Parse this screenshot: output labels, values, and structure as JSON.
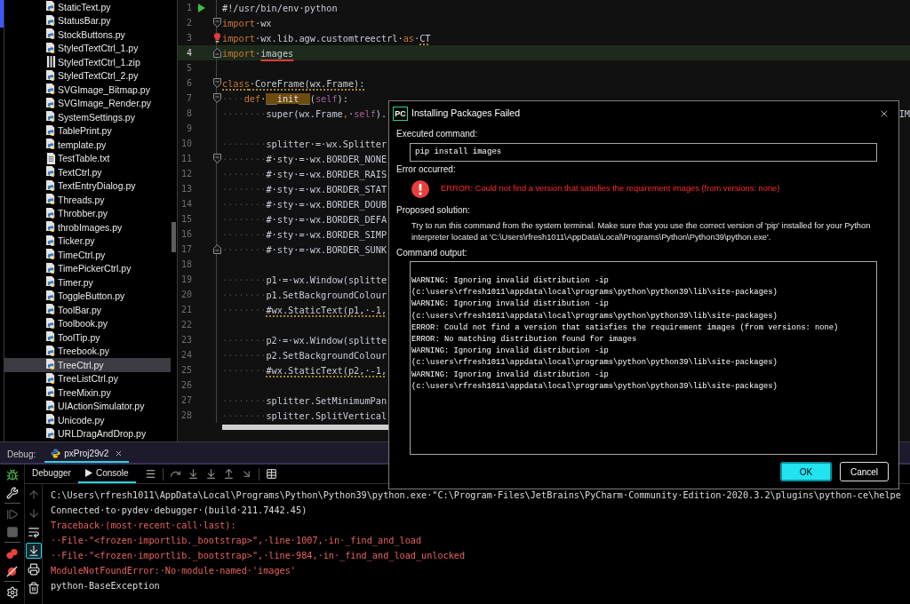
{
  "project_tree": {
    "items": [
      {
        "name": "StaticText.py",
        "kind": "python",
        "selected": false
      },
      {
        "name": "StatusBar.py",
        "kind": "python",
        "selected": false
      },
      {
        "name": "StockButtons.py",
        "kind": "python",
        "selected": false
      },
      {
        "name": "StyledTextCtrl_1.py",
        "kind": "python",
        "selected": false
      },
      {
        "name": "StyledTextCtrl_1.zip",
        "kind": "archive",
        "selected": false
      },
      {
        "name": "StyledTextCtrl_2.py",
        "kind": "python",
        "selected": false
      },
      {
        "name": "SVGImage_Bitmap.py",
        "kind": "python",
        "selected": false
      },
      {
        "name": "SVGImage_Render.py",
        "kind": "python",
        "selected": false
      },
      {
        "name": "SystemSettings.py",
        "kind": "python",
        "selected": false
      },
      {
        "name": "TablePrint.py",
        "kind": "python",
        "selected": false
      },
      {
        "name": "template.py",
        "kind": "python",
        "selected": false
      },
      {
        "name": "TestTable.txt",
        "kind": "text",
        "selected": false
      },
      {
        "name": "TextCtrl.py",
        "kind": "python",
        "selected": false
      },
      {
        "name": "TextEntryDialog.py",
        "kind": "python",
        "selected": false
      },
      {
        "name": "Threads.py",
        "kind": "python",
        "selected": false
      },
      {
        "name": "Throbber.py",
        "kind": "python",
        "selected": false
      },
      {
        "name": "throbImages.py",
        "kind": "python",
        "selected": false
      },
      {
        "name": "Ticker.py",
        "kind": "python",
        "selected": false
      },
      {
        "name": "TimeCtrl.py",
        "kind": "python",
        "selected": false
      },
      {
        "name": "TimePickerCtrl.py",
        "kind": "python",
        "selected": false
      },
      {
        "name": "Timer.py",
        "kind": "python",
        "selected": false
      },
      {
        "name": "ToggleButton.py",
        "kind": "python",
        "selected": false
      },
      {
        "name": "ToolBar.py",
        "kind": "python",
        "selected": false
      },
      {
        "name": "Toolbook.py",
        "kind": "python",
        "selected": false
      },
      {
        "name": "ToolTip.py",
        "kind": "python",
        "selected": false
      },
      {
        "name": "Treebook.py",
        "kind": "python",
        "selected": false
      },
      {
        "name": "TreeCtrl.py",
        "kind": "python",
        "selected": true
      },
      {
        "name": "TreeListCtrl.py",
        "kind": "python",
        "selected": false
      },
      {
        "name": "TreeMixin.py",
        "kind": "python",
        "selected": false
      },
      {
        "name": "UIActionSimulator.py",
        "kind": "python",
        "selected": false
      },
      {
        "name": "Unicode.py",
        "kind": "python",
        "selected": false
      },
      {
        "name": "URLDragAndDrop.py",
        "kind": "python",
        "selected": false
      }
    ]
  },
  "editor": {
    "lines": [
      {
        "number": "1",
        "current": false,
        "gutter": [
          {
            "kind": "run"
          }
        ],
        "segments": [
          {
            "kind": "plain",
            "text": "#!/usr/bin/env·python"
          }
        ]
      },
      {
        "number": "2",
        "current": false,
        "gutter": [
          {
            "kind": "fold-start"
          }
        ],
        "segments": [
          {
            "kind": "keyword",
            "text": "import"
          },
          {
            "kind": "plain",
            "text": "·wx"
          }
        ]
      },
      {
        "number": "3",
        "current": false,
        "gutter": [
          {
            "kind": "error-bulb"
          }
        ],
        "segments": [
          {
            "kind": "keyword",
            "text": "import"
          },
          {
            "kind": "plain",
            "text": "·wx.lib.agw.customtreectrl·"
          },
          {
            "kind": "keyword",
            "text": "as"
          },
          {
            "kind": "plain",
            "text": "·"
          },
          {
            "kind": "plain-dotted",
            "text": "CT"
          }
        ]
      },
      {
        "number": "4",
        "current": true,
        "gutter": [
          {
            "kind": "fold-end"
          }
        ],
        "segments": [
          {
            "kind": "keyword",
            "text": "import"
          },
          {
            "kind": "plain",
            "text": "·"
          },
          {
            "kind": "plain-error",
            "text": "images"
          }
        ]
      },
      {
        "number": "5",
        "current": false
      },
      {
        "number": "6",
        "current": false,
        "gutter": [
          {
            "kind": "fold-start"
          }
        ],
        "segments": [
          {
            "kind": "keyword-dotted",
            "text": "class"
          },
          {
            "kind": "plain-dotted",
            "text": "·CoreFrame(wx.Frame):"
          }
        ]
      },
      {
        "number": "7",
        "current": false,
        "gutter": [
          {
            "kind": "fold-start"
          }
        ],
        "segments": [
          {
            "kind": "indent",
            "text": "····"
          },
          {
            "kind": "keyword",
            "text": "def"
          },
          {
            "kind": "plain",
            "text": "·"
          },
          {
            "kind": "highlight",
            "text": "__init__"
          },
          {
            "kind": "plain",
            "text": "("
          },
          {
            "kind": "self",
            "text": "self"
          },
          {
            "kind": "plain",
            "text": "):"
          }
        ]
      },
      {
        "number": "8",
        "current": false,
        "segments": [
          {
            "kind": "indent",
            "text": "········"
          },
          {
            "kind": "plain",
            "text": "super(wx.Frame"
          },
          {
            "kind": "keyword",
            "text": ","
          },
          {
            "kind": "plain",
            "text": "·"
          },
          {
            "kind": "self",
            "text": "self"
          },
          {
            "kind": "plain",
            "text": ")."
          }
        ],
        "tail": "IM"
      },
      {
        "number": "9",
        "current": false
      },
      {
        "number": "10",
        "current": false,
        "segments": [
          {
            "kind": "indent",
            "text": "········"
          },
          {
            "kind": "plain",
            "text": "splitter·=·wx.Splitter"
          }
        ]
      },
      {
        "number": "11",
        "current": false,
        "gutter": [
          {
            "kind": "fold-start"
          }
        ],
        "segments": [
          {
            "kind": "indent",
            "text": "········"
          },
          {
            "kind": "plain",
            "text": "#·sty·=·wx.BORDER_NONE"
          }
        ]
      },
      {
        "number": "12",
        "current": false,
        "segments": [
          {
            "kind": "indent",
            "text": "········"
          },
          {
            "kind": "plain",
            "text": "#·sty·=·wx.BORDER_RAIS"
          }
        ]
      },
      {
        "number": "13",
        "current": false,
        "segments": [
          {
            "kind": "indent",
            "text": "········"
          },
          {
            "kind": "plain",
            "text": "#·sty·=·wx.BORDER_STAT"
          }
        ]
      },
      {
        "number": "14",
        "current": false,
        "segments": [
          {
            "kind": "indent",
            "text": "········"
          },
          {
            "kind": "plain",
            "text": "#·sty·=·wx.BORDER_DOUB"
          }
        ]
      },
      {
        "number": "15",
        "current": false,
        "segments": [
          {
            "kind": "indent",
            "text": "········"
          },
          {
            "kind": "plain",
            "text": "#·sty·=·wx.BORDER_DEFA"
          }
        ]
      },
      {
        "number": "16",
        "current": false,
        "segments": [
          {
            "kind": "indent",
            "text": "········"
          },
          {
            "kind": "plain",
            "text": "#·sty·=·wx.BORDER_SIMP"
          }
        ]
      },
      {
        "number": "17",
        "current": false,
        "gutter": [
          {
            "kind": "fold-end"
          }
        ],
        "segments": [
          {
            "kind": "indent",
            "text": "········"
          },
          {
            "kind": "plain",
            "text": "#·sty·=·wx.BORDER_SUNK"
          }
        ]
      },
      {
        "number": "18",
        "current": false
      },
      {
        "number": "19",
        "current": false,
        "segments": [
          {
            "kind": "indent",
            "text": "········"
          },
          {
            "kind": "plain",
            "text": "p1·=·wx.Window(splitte"
          }
        ]
      },
      {
        "number": "20",
        "current": false,
        "segments": [
          {
            "kind": "indent",
            "text": "········"
          },
          {
            "kind": "plain",
            "text": "p1.SetBackgroundColour"
          }
        ]
      },
      {
        "number": "21",
        "current": false,
        "segments": [
          {
            "kind": "indent",
            "text": "········"
          },
          {
            "kind": "plain-dotted",
            "text": "#wx.StaticText(p1,·-1,"
          }
        ]
      },
      {
        "number": "22",
        "current": false
      },
      {
        "number": "23",
        "current": false,
        "segments": [
          {
            "kind": "indent",
            "text": "········"
          },
          {
            "kind": "plain",
            "text": "p2·=·wx.Window(splitte"
          }
        ]
      },
      {
        "number": "24",
        "current": false,
        "segments": [
          {
            "kind": "indent",
            "text": "········"
          },
          {
            "kind": "plain",
            "text": "p2.SetBackgroundColour"
          }
        ]
      },
      {
        "number": "25",
        "current": false,
        "segments": [
          {
            "kind": "indent",
            "text": "········"
          },
          {
            "kind": "plain-dotted",
            "text": "#wx.StaticText(p2,·-1,"
          }
        ]
      },
      {
        "number": "26",
        "current": false
      },
      {
        "number": "27",
        "current": false,
        "segments": [
          {
            "kind": "indent",
            "text": "········"
          },
          {
            "kind": "plain",
            "text": "splitter.SetMinimumPan"
          }
        ]
      },
      {
        "number": "28",
        "current": false,
        "segments": [
          {
            "kind": "indent",
            "text": "········"
          },
          {
            "kind": "plain",
            "text": "splitter.SplitVertical"
          }
        ]
      }
    ]
  },
  "dialog": {
    "logo_text": "PC",
    "title": "Installing Packages Failed",
    "executed_label": "Executed command:",
    "command": "pip install images",
    "error_label": "Error occurred:",
    "error_message": "ERROR: Could not find a version that satisfies the requirement images (from versions: none)",
    "solution_label": "Proposed solution:",
    "solution_text": "Try to run this command from the system terminal. Make sure that you use the correct version of 'pip' installed for your Python interpreter located at 'C:\\Users\\rfresh1011\\AppData\\Local\\Programs\\Python\\Python39\\python.exe'.",
    "output_label": "Command output:",
    "output_lines": [
      "WARNING: Ignoring invalid distribution -ip",
      "(c:\\users\\rfresh1011\\appdata\\local\\programs\\python\\python39\\lib\\site-packages)",
      "WARNING: Ignoring invalid distribution -ip",
      "(c:\\users\\rfresh1011\\appdata\\local\\programs\\python\\python39\\lib\\site-packages)",
      "ERROR: Could not find a version that satisfies the requirement images (from versions: none)",
      "ERROR: No matching distribution found for images",
      "WARNING: Ignoring invalid distribution -ip",
      "(c:\\users\\rfresh1011\\appdata\\local\\programs\\python\\python39\\lib\\site-packages)",
      "WARNING: Ignoring invalid distribution -ip",
      "(c:\\users\\rfresh1011\\appdata\\local\\programs\\python\\python39\\lib\\site-packages)"
    ],
    "buttons": [
      {
        "label": "OK",
        "focused": true
      },
      {
        "label": "Cancel",
        "focused": false
      }
    ]
  },
  "debug_panel": {
    "label": "Debug:",
    "run_tabs": [
      {
        "label": "pxProj29v2",
        "selected": true
      }
    ],
    "tool_tabs": [
      {
        "label": "Debugger",
        "kind": "debugger",
        "selected": false
      },
      {
        "label": "Console",
        "kind": "console",
        "selected": true
      }
    ],
    "left_tool_groups": [
      [
        {
          "kind": "debug",
          "disabled": false
        },
        {
          "kind": "wrench",
          "disabled": false
        }
      ],
      [
        {
          "kind": "resume",
          "disabled": true
        },
        {
          "kind": "stop",
          "disabled": true
        }
      ],
      [
        {
          "kind": "breakpoints",
          "disabled": false
        },
        {
          "kind": "mute-breakpoints",
          "disabled": false
        }
      ],
      [
        {
          "kind": "settings",
          "disabled": false
        }
      ]
    ],
    "console_tools": [
      {
        "kind": "up",
        "disabled": true,
        "on": false
      },
      {
        "kind": "down",
        "disabled": true,
        "on": false
      },
      {
        "kind": "soft-wrap",
        "disabled": false,
        "on": false
      },
      {
        "kind": "scroll-end",
        "disabled": false,
        "on": true
      },
      {
        "kind": "print",
        "disabled": false,
        "on": false
      },
      {
        "kind": "clear",
        "disabled": false,
        "on": false
      }
    ],
    "console_lines": [
      {
        "kind": "output",
        "text": "C:\\Users\\rfresh1011\\AppData\\Local\\Programs\\Python\\Python39\\python.exe·\"C:\\Program·Files\\JetBrains\\PyCharm·Community·Edition·2020.3.2\\plugins\\python-ce\\helpe"
      },
      {
        "kind": "output",
        "text": "Connected·to·pydev·debugger·(build·211.7442.45)"
      },
      {
        "kind": "error",
        "text": "Traceback·(most·recent·call·last):"
      },
      {
        "kind": "error",
        "text": "··File·\"<frozen·importlib._bootstrap>\",·line·1007,·in·_find_and_load"
      },
      {
        "kind": "error",
        "text": "··File·\"<frozen·importlib._bootstrap>\",·line·984,·in·_find_and_load_unlocked"
      },
      {
        "kind": "error",
        "text": "ModuleNotFoundError:·No·module·named·'images'"
      },
      {
        "kind": "output",
        "text": "python-BaseException"
      }
    ]
  }
}
